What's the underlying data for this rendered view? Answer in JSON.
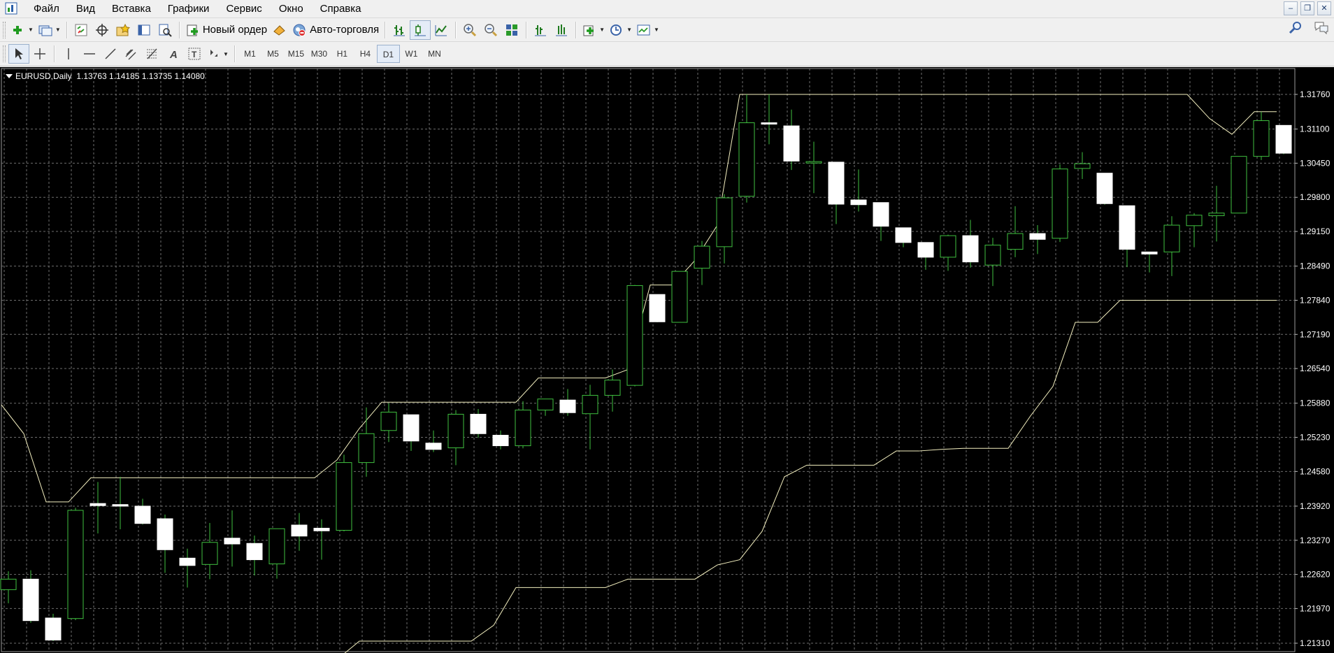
{
  "menu": {
    "items": [
      "Файл",
      "Вид",
      "Вставка",
      "Графики",
      "Сервис",
      "Окно",
      "Справка"
    ]
  },
  "toolbar": {
    "new_order_label": "Новый ордер",
    "autotrading_label": "Авто-торговля"
  },
  "timeframes": {
    "items": [
      "M1",
      "M5",
      "M15",
      "M30",
      "H1",
      "H4",
      "D1",
      "W1",
      "MN"
    ],
    "active": "D1"
  },
  "chart_header": {
    "title": "EURUSD,Daily  1.13763 1.14185 1.13735 1.14080"
  },
  "colors": {
    "background": "#000000",
    "grid": "#6e6e6e",
    "bull_body": "#000000",
    "bull_border": "#3fbf3f",
    "bear_body": "#ffffff",
    "wick": "#3fbf3f",
    "channel": "#f4f0c0",
    "axis_text": "#ffffff"
  },
  "icons": {
    "toolbar1": [
      "new-chart-icon",
      "profiles-icon",
      "market-watch-icon",
      "data-window-icon",
      "navigator-icon",
      "terminal-icon",
      "strategy-tester-icon",
      "new-order-icon",
      "autotrading-icon",
      "bar-chart-icon",
      "candlestick-chart-icon",
      "line-chart-icon",
      "zoom-in-icon",
      "zoom-out-icon",
      "tile-windows-icon",
      "chart-shift-icon",
      "autoscroll-icon",
      "indicators-icon",
      "periods-icon",
      "templates-icon",
      "search-icon",
      "chat-icon"
    ],
    "toolbar2": [
      "cursor-icon",
      "crosshair-icon",
      "vertical-line-icon",
      "horizontal-line-icon",
      "trendline-icon",
      "equidistant-channel-icon",
      "fibonacci-icon",
      "text-icon",
      "text-label-icon",
      "arrows-icon"
    ]
  },
  "chart_data": {
    "type": "candlestick",
    "symbol": "EURUSD",
    "timeframe": "Daily",
    "price_ticks": [
      "1.31760",
      "1.31100",
      "1.30450",
      "1.29800",
      "1.29150",
      "1.28490",
      "1.27840",
      "1.27190",
      "1.26540",
      "1.25880",
      "1.25230",
      "1.24580",
      "1.23920",
      "1.23270",
      "1.22620",
      "1.21970",
      "1.21310"
    ],
    "ylim": [
      1.2118,
      1.3196
    ],
    "grid": true,
    "candles": [
      {
        "o": 1.2233,
        "h": 1.2268,
        "l": 1.2207,
        "c": 1.2253
      },
      {
        "o": 1.2253,
        "h": 1.227,
        "l": 1.217,
        "c": 1.2174
      },
      {
        "o": 1.2179,
        "h": 1.2187,
        "l": 1.2135,
        "c": 1.2137
      },
      {
        "o": 1.2178,
        "h": 1.2389,
        "l": 1.2175,
        "c": 1.2384
      },
      {
        "o": 1.2397,
        "h": 1.2438,
        "l": 1.234,
        "c": 1.2393
      },
      {
        "o": 1.2395,
        "h": 1.2448,
        "l": 1.2348,
        "c": 1.2392
      },
      {
        "o": 1.2392,
        "h": 1.2406,
        "l": 1.2357,
        "c": 1.2359
      },
      {
        "o": 1.2368,
        "h": 1.2376,
        "l": 1.2265,
        "c": 1.2309
      },
      {
        "o": 1.2293,
        "h": 1.2311,
        "l": 1.2237,
        "c": 1.2279
      },
      {
        "o": 1.2281,
        "h": 1.236,
        "l": 1.2253,
        "c": 1.2323
      },
      {
        "o": 1.2331,
        "h": 1.2384,
        "l": 1.2277,
        "c": 1.232
      },
      {
        "o": 1.2321,
        "h": 1.2336,
        "l": 1.226,
        "c": 1.229
      },
      {
        "o": 1.2282,
        "h": 1.2349,
        "l": 1.2254,
        "c": 1.2349
      },
      {
        "o": 1.2356,
        "h": 1.2379,
        "l": 1.2307,
        "c": 1.2335
      },
      {
        "o": 1.235,
        "h": 1.2367,
        "l": 1.229,
        "c": 1.2345
      },
      {
        "o": 1.2346,
        "h": 1.249,
        "l": 1.2344,
        "c": 1.2475
      },
      {
        "o": 1.2475,
        "h": 1.258,
        "l": 1.2448,
        "c": 1.253
      },
      {
        "o": 1.2536,
        "h": 1.2588,
        "l": 1.2514,
        "c": 1.2571
      },
      {
        "o": 1.2566,
        "h": 1.2566,
        "l": 1.2497,
        "c": 1.2516
      },
      {
        "o": 1.2512,
        "h": 1.2536,
        "l": 1.2495,
        "c": 1.25
      },
      {
        "o": 1.2503,
        "h": 1.2575,
        "l": 1.247,
        "c": 1.2567
      },
      {
        "o": 1.2567,
        "h": 1.2577,
        "l": 1.2522,
        "c": 1.253
      },
      {
        "o": 1.2527,
        "h": 1.2536,
        "l": 1.25,
        "c": 1.2507
      },
      {
        "o": 1.2507,
        "h": 1.2592,
        "l": 1.2502,
        "c": 1.2575
      },
      {
        "o": 1.2575,
        "h": 1.2596,
        "l": 1.2564,
        "c": 1.2596
      },
      {
        "o": 1.2594,
        "h": 1.2615,
        "l": 1.2564,
        "c": 1.257
      },
      {
        "o": 1.2568,
        "h": 1.2623,
        "l": 1.25,
        "c": 1.2603
      },
      {
        "o": 1.2603,
        "h": 1.2652,
        "l": 1.2572,
        "c": 1.2632
      },
      {
        "o": 1.2622,
        "h": 1.2813,
        "l": 1.262,
        "c": 1.2812
      },
      {
        "o": 1.2795,
        "h": 1.2795,
        "l": 1.2742,
        "c": 1.2743
      },
      {
        "o": 1.2742,
        "h": 1.2832,
        "l": 1.2742,
        "c": 1.2839
      },
      {
        "o": 1.2845,
        "h": 1.2897,
        "l": 1.2813,
        "c": 1.2887
      },
      {
        "o": 1.2886,
        "h": 1.2986,
        "l": 1.2854,
        "c": 1.2979
      },
      {
        "o": 1.2982,
        "h": 1.3176,
        "l": 1.297,
        "c": 1.3122
      },
      {
        "o": 1.3122,
        "h": 1.3176,
        "l": 1.3081,
        "c": 1.312
      },
      {
        "o": 1.3116,
        "h": 1.3147,
        "l": 1.3032,
        "c": 1.3049
      },
      {
        "o": 1.3048,
        "h": 1.3086,
        "l": 1.2988,
        "c": 1.3048
      },
      {
        "o": 1.3047,
        "h": 1.3047,
        "l": 1.2929,
        "c": 1.2967
      },
      {
        "o": 1.2975,
        "h": 1.3033,
        "l": 1.2953,
        "c": 1.2966
      },
      {
        "o": 1.297,
        "h": 1.297,
        "l": 1.2897,
        "c": 1.2925
      },
      {
        "o": 1.2922,
        "h": 1.2922,
        "l": 1.2885,
        "c": 1.2894
      },
      {
        "o": 1.2894,
        "h": 1.2894,
        "l": 1.2842,
        "c": 1.2866
      },
      {
        "o": 1.2866,
        "h": 1.2909,
        "l": 1.284,
        "c": 1.2907
      },
      {
        "o": 1.2907,
        "h": 1.2937,
        "l": 1.2846,
        "c": 1.2857
      },
      {
        "o": 1.2851,
        "h": 1.2903,
        "l": 1.2811,
        "c": 1.2889
      },
      {
        "o": 1.2881,
        "h": 1.2963,
        "l": 1.2866,
        "c": 1.2911
      },
      {
        "o": 1.2911,
        "h": 1.2927,
        "l": 1.2872,
        "c": 1.29
      },
      {
        "o": 1.2902,
        "h": 1.3043,
        "l": 1.2895,
        "c": 1.3034
      },
      {
        "o": 1.3035,
        "h": 1.3066,
        "l": 1.3015,
        "c": 1.3044
      },
      {
        "o": 1.3026,
        "h": 1.3026,
        "l": 1.2966,
        "c": 1.2968
      },
      {
        "o": 1.2964,
        "h": 1.2964,
        "l": 1.2847,
        "c": 1.2881
      },
      {
        "o": 1.2876,
        "h": 1.2876,
        "l": 1.2837,
        "c": 1.2872
      },
      {
        "o": 1.2876,
        "h": 1.2944,
        "l": 1.283,
        "c": 1.2927
      },
      {
        "o": 1.2926,
        "h": 1.295,
        "l": 1.2885,
        "c": 1.2946
      },
      {
        "o": 1.2945,
        "h": 1.3002,
        "l": 1.2896,
        "c": 1.295
      },
      {
        "o": 1.295,
        "h": 1.3058,
        "l": 1.295,
        "c": 1.3058
      },
      {
        "o": 1.3058,
        "h": 1.3143,
        "l": 1.3051,
        "c": 1.3126
      },
      {
        "o": 1.3117,
        "h": 1.3117,
        "l": 1.3062,
        "c": 1.3064
      }
    ],
    "channel_upper": [
      1.2585,
      1.253,
      1.24,
      1.24,
      1.2446,
      1.2446,
      1.2446,
      1.2446,
      1.2446,
      1.2446,
      1.2446,
      1.2446,
      1.2446,
      1.2446,
      1.2446,
      1.248,
      1.254,
      1.259,
      1.259,
      1.259,
      1.259,
      1.259,
      1.259,
      1.259,
      1.2636,
      1.2636,
      1.2636,
      1.2636,
      1.2652,
      1.2813,
      1.2813,
      1.286,
      1.2927,
      1.3176,
      1.3176,
      1.3176,
      1.3176,
      1.3176,
      1.3176,
      1.3176,
      1.3176,
      1.3176,
      1.3176,
      1.3176,
      1.3176,
      1.3176,
      1.3176,
      1.3176,
      1.3176,
      1.3176,
      1.3176,
      1.3176,
      1.3176,
      1.3176,
      1.313,
      1.31,
      1.3143,
      1.3143
    ],
    "channel_lower": [
      1.21,
      1.21,
      1.21,
      1.21,
      1.21,
      1.21,
      1.21,
      1.21,
      1.21,
      1.21,
      1.21,
      1.21,
      1.21,
      1.21,
      1.21,
      1.21,
      1.2135,
      1.2135,
      1.2135,
      1.2135,
      1.2135,
      1.2135,
      1.2165,
      1.2237,
      1.2237,
      1.2237,
      1.2237,
      1.2237,
      1.2253,
      1.2253,
      1.2253,
      1.2253,
      1.228,
      1.229,
      1.2344,
      1.2448,
      1.247,
      1.247,
      1.247,
      1.247,
      1.2497,
      1.2497,
      1.25,
      1.2502,
      1.2502,
      1.2502,
      1.2564,
      1.262,
      1.2742,
      1.2742,
      1.2784,
      1.2784,
      1.2784,
      1.2784,
      1.2784,
      1.2784,
      1.2784,
      1.2784
    ]
  }
}
